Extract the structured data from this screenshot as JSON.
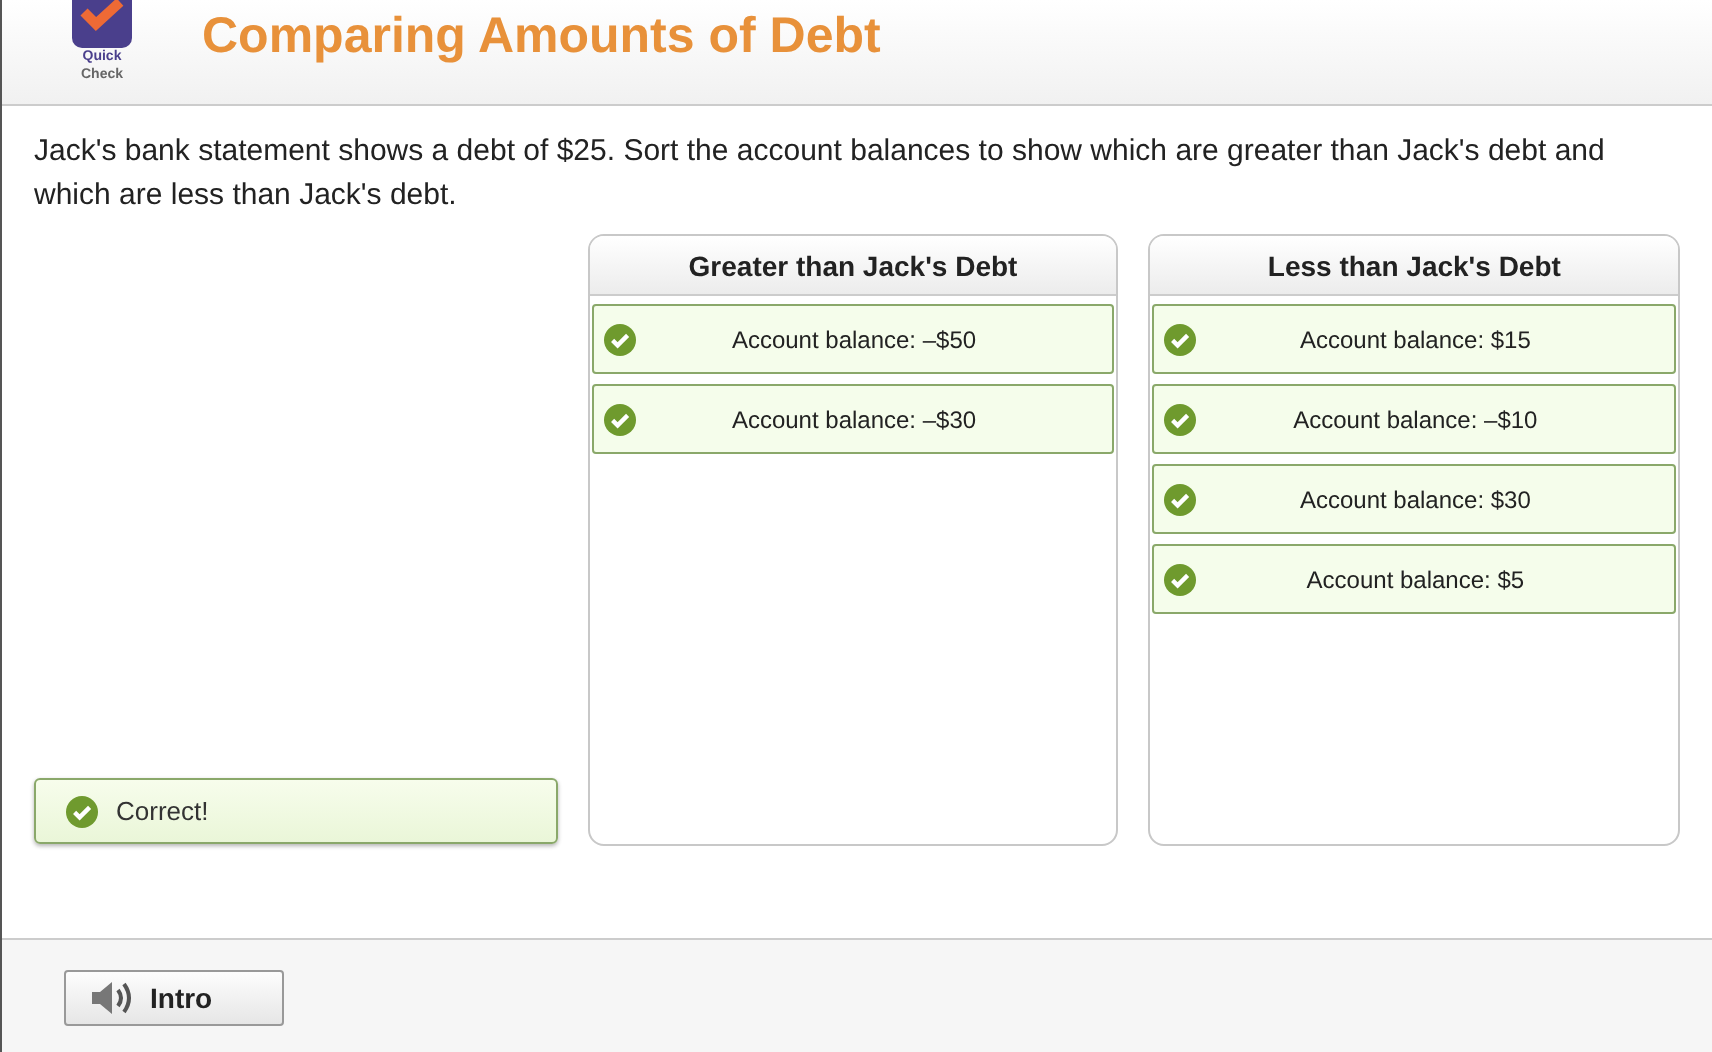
{
  "header": {
    "logo_text": [
      "Quick",
      "Check"
    ],
    "title": "Comparing Amounts of Debt"
  },
  "prompt": "Jack's bank statement shows a debt of $25. Sort the account balances to show which are greater than Jack's debt and which are less than Jack's debt.",
  "feedback": {
    "text": "Correct!",
    "correct": true
  },
  "bins": [
    {
      "title": "Greater than Jack's Debt",
      "items": [
        {
          "label": "Account balance: –$50",
          "correct": true
        },
        {
          "label": "Account balance: –$30",
          "correct": true
        }
      ]
    },
    {
      "title": "Less than Jack's Debt",
      "items": [
        {
          "label": "Account balance: $15",
          "correct": true
        },
        {
          "label": "Account balance: –$10",
          "correct": true
        },
        {
          "label": "Account balance: $30",
          "correct": true
        },
        {
          "label": "Account balance: $5",
          "correct": true
        }
      ]
    }
  ],
  "footer": {
    "buttons": [
      "Intro"
    ]
  }
}
